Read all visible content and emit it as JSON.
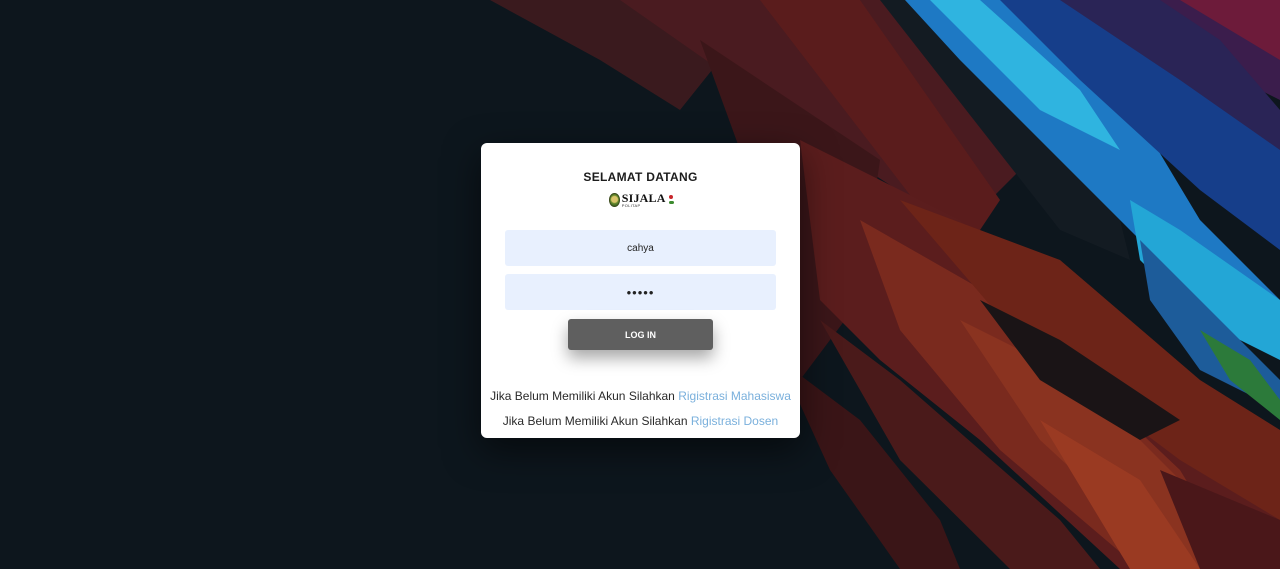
{
  "page": {
    "heading": "SELAMAT DATANG",
    "logo": {
      "name": "SIJALA",
      "subtitle": "POLITAP"
    }
  },
  "form": {
    "username_value": "cahya",
    "password_value": "•••••",
    "login_label": "LOG IN"
  },
  "register": {
    "mahasiswa": {
      "prefix": "Jika Belum Memiliki Akun Silahkan ",
      "link": "Rigistrasi Mahasiswa"
    },
    "dosen": {
      "prefix": "Jika Belum Memiliki Akun Silahkan ",
      "link": "Rigistrasi Dosen"
    }
  },
  "colors": {
    "background": "#0d161d",
    "card": "#ffffff",
    "input_fill": "#e8f0fe",
    "button": "#5f5f5f",
    "link": "#7ab0dc"
  }
}
